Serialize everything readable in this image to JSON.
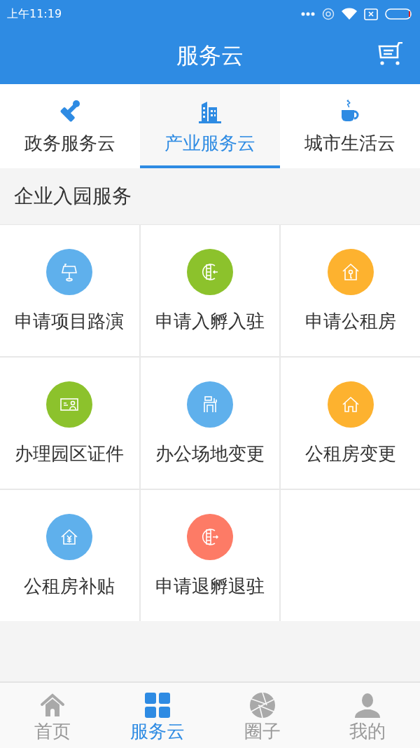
{
  "status_bar": {
    "time": "上午11:19"
  },
  "header": {
    "title": "服务云"
  },
  "tabs": [
    {
      "label": "政务服务云",
      "kind": "stamp",
      "selected": false
    },
    {
      "label": "产业服务云",
      "kind": "buildings",
      "selected": true
    },
    {
      "label": "城市生活云",
      "kind": "cup",
      "selected": false
    }
  ],
  "section": {
    "title": "企业入园服务"
  },
  "services": [
    {
      "label": "申请项目路演",
      "kind": "lamp",
      "color": "#5fb0ec"
    },
    {
      "label": "申请入孵入驻",
      "kind": "enter",
      "color": "#8cc22c"
    },
    {
      "label": "申请公租房",
      "kind": "housekey",
      "color": "#fdb22f"
    },
    {
      "label": "办理园区证件",
      "kind": "card",
      "color": "#8cc22c"
    },
    {
      "label": "办公场地变更",
      "kind": "desk",
      "color": "#5fb0ec"
    },
    {
      "label": "公租房变更",
      "kind": "house",
      "color": "#fdb22f"
    },
    {
      "label": "公租房补贴",
      "kind": "houseyen",
      "color": "#5fb0ec"
    },
    {
      "label": "申请退孵退驻",
      "kind": "exit",
      "color": "#fd7b66"
    }
  ],
  "bottom_nav": [
    {
      "label": "首页",
      "kind": "home",
      "selected": false
    },
    {
      "label": "服务云",
      "kind": "grid",
      "selected": true
    },
    {
      "label": "圈子",
      "kind": "aperture",
      "selected": false
    },
    {
      "label": "我的",
      "kind": "person",
      "selected": false
    }
  ]
}
